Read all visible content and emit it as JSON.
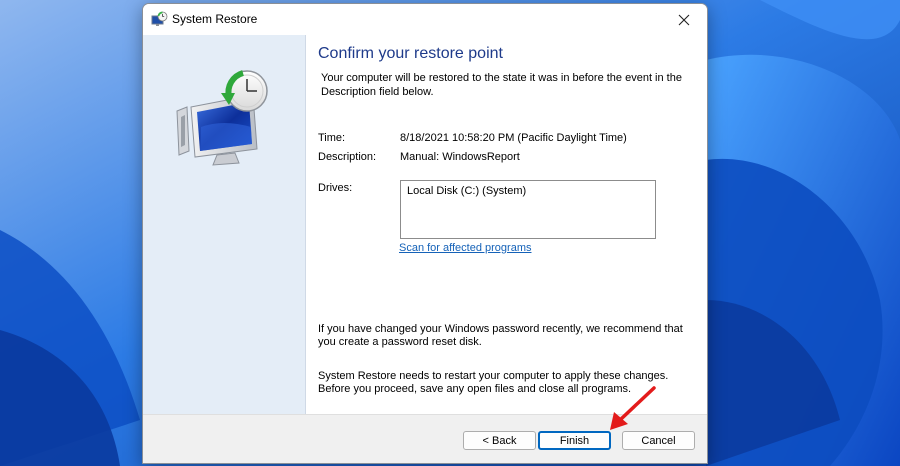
{
  "window": {
    "title": "System Restore"
  },
  "main": {
    "heading": "Confirm your restore point",
    "intro": "Your computer will be restored to the state it was in before the event in the Description field below.",
    "time_label": "Time:",
    "time_value": "8/18/2021 10:58:20 PM (Pacific Daylight Time)",
    "description_label": "Description:",
    "description_value": "Manual: WindowsReport",
    "drives_label": "Drives:",
    "drives": [
      "Local Disk (C:) (System)"
    ],
    "scan_link": "Scan for affected programs",
    "password_note": "If you have changed your Windows password recently, we recommend that you create a password reset disk.",
    "restart_note": "System Restore needs to restart your computer to apply these changes. Before you proceed, save any open files and close all programs."
  },
  "footer": {
    "back_label": "< Back",
    "finish_label": "Finish",
    "cancel_label": "Cancel"
  },
  "icons": {
    "title": "system-restore-icon",
    "close": "close-icon",
    "sidebar": "system-restore-logo-icon",
    "annotation": "red-arrow-icon"
  },
  "colors": {
    "heading": "#1e3a8a",
    "link": "#1562b8",
    "sidebar": "#e4edf7",
    "default_button_border": "#0067c0",
    "annotation_arrow": "#e31b1b"
  }
}
